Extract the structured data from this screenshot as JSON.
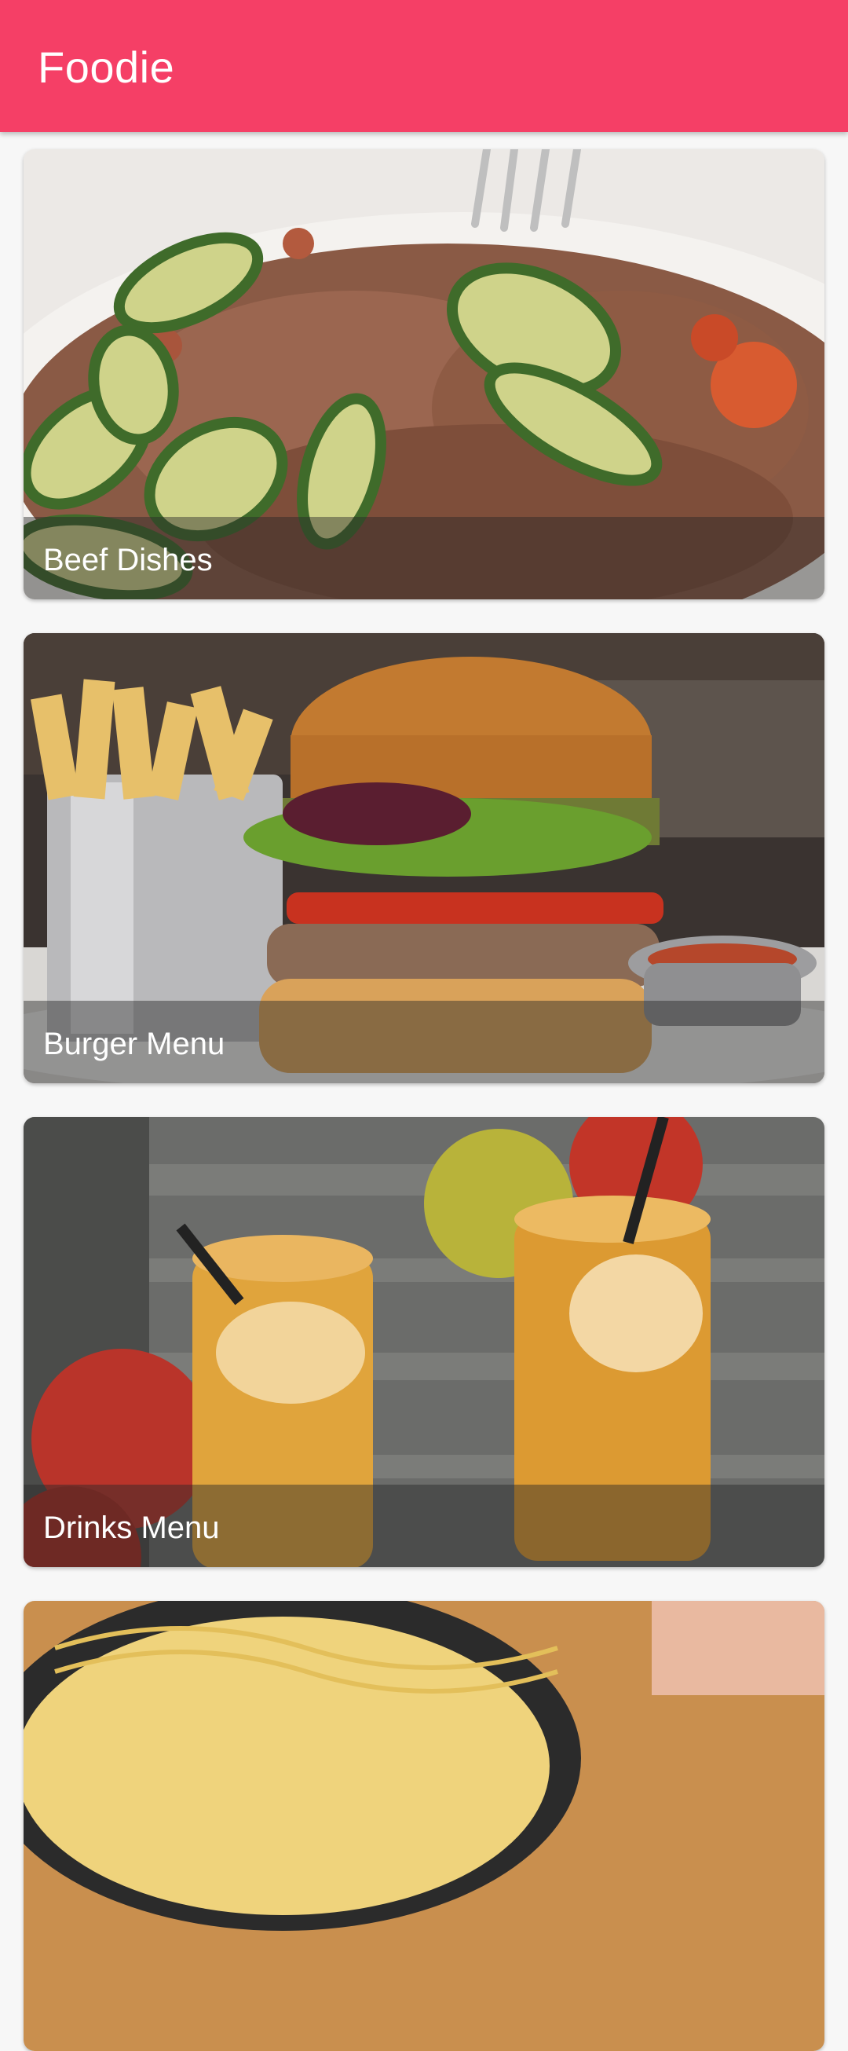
{
  "app_bar": {
    "title": "Foodie",
    "color": "#f53f66"
  },
  "categories": [
    {
      "label": "Beef Dishes",
      "image": "beef-with-zucchini-photo"
    },
    {
      "label": "Burger Menu",
      "image": "burger-and-fries-photo"
    },
    {
      "label": "Drinks Menu",
      "image": "apple-iced-tea-photo"
    },
    {
      "label": "",
      "image": "pasta-photo"
    }
  ]
}
